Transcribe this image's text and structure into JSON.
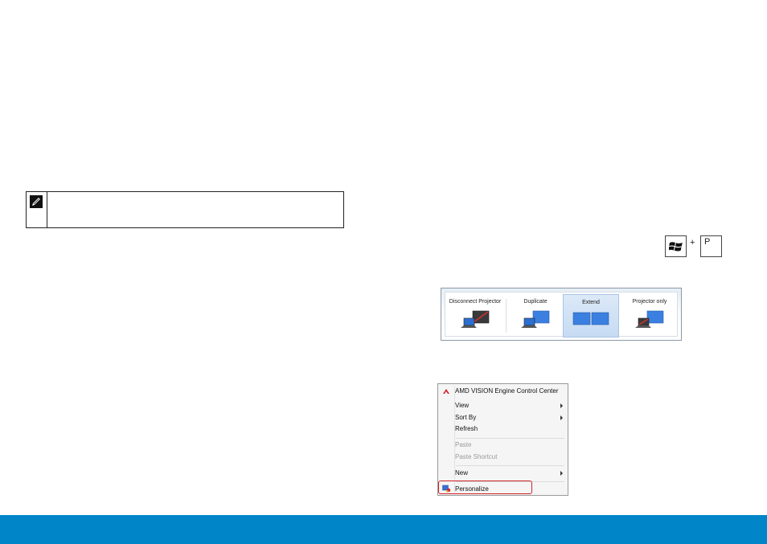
{
  "projector_switcher": {
    "options": [
      {
        "label": "Disconnect Projector"
      },
      {
        "label": "Duplicate"
      },
      {
        "label": "Extend"
      },
      {
        "label": "Projector only"
      }
    ],
    "selected": "Extend"
  },
  "shortcut": {
    "plus": "+",
    "key": "P"
  },
  "context_menu": {
    "items": [
      {
        "label": "AMD VISION Engine Control Center"
      },
      {
        "label": "View"
      },
      {
        "label": "Sort By"
      },
      {
        "label": "Refresh"
      },
      {
        "label": "Paste"
      },
      {
        "label": "Paste Shortcut"
      },
      {
        "label": "New"
      },
      {
        "label": "Personalize"
      }
    ]
  },
  "colors": {
    "footer": "#0085c8",
    "highlight": "#d2232a",
    "selected_option": "#c6dbf3"
  }
}
